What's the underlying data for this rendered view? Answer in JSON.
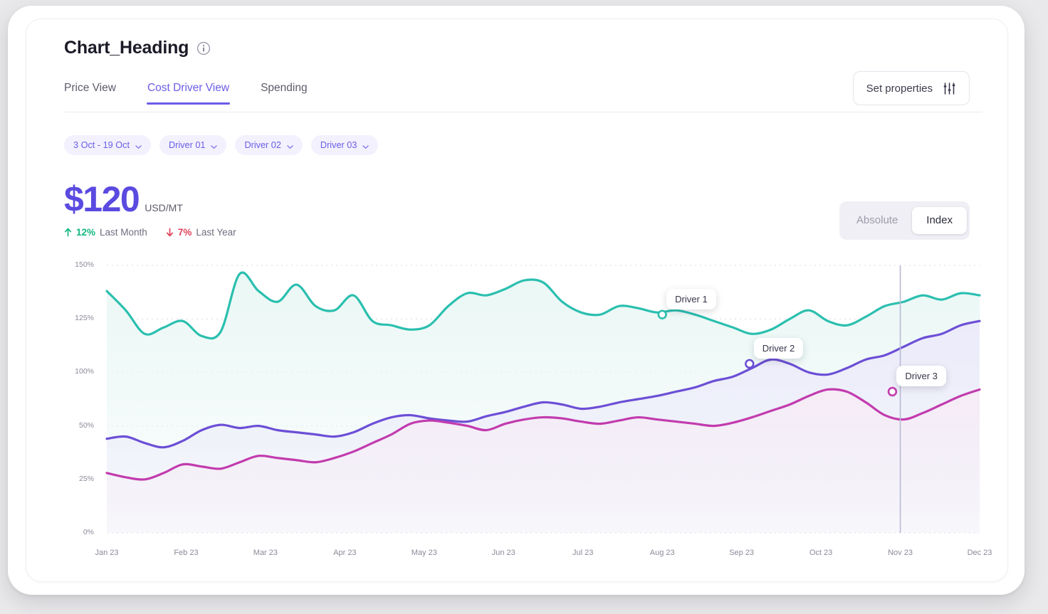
{
  "header": {
    "title": "Chart_Heading",
    "info_icon": "info-circle-icon"
  },
  "tabs": [
    {
      "label": "Price View",
      "active": false
    },
    {
      "label": "Cost Driver View",
      "active": true
    },
    {
      "label": "Spending",
      "active": false
    }
  ],
  "toolbar": {
    "set_properties_label": "Set properties",
    "set_properties_icon": "sliders-icon"
  },
  "filters": [
    {
      "label": "3 Oct - 19 Oct",
      "icon": "chevron-down-icon"
    },
    {
      "label": "Driver 01",
      "icon": "chevron-down-icon"
    },
    {
      "label": "Driver 02",
      "icon": "chevron-down-icon"
    },
    {
      "label": "Driver 03",
      "icon": "chevron-down-icon"
    }
  ],
  "kpi": {
    "value": "$120",
    "unit": "USD/MT",
    "deltas": [
      {
        "direction": "up",
        "icon": "arrow-up-icon",
        "value": "12%",
        "period": "Last Month"
      },
      {
        "direction": "down",
        "icon": "arrow-down-icon",
        "value": "7%",
        "period": "Last Year"
      }
    ]
  },
  "scale_toggle": {
    "options": [
      "Absolute",
      "Index"
    ],
    "selected": "Index"
  },
  "colors": {
    "accent": "#6c5ce7",
    "kpi_value": "#5b4ae0",
    "up": "#14b87d",
    "down": "#e0445c",
    "driver1": "#2bbfaf",
    "driver2": "#6c4fd6",
    "driver3": "#c23bae",
    "chip_bg": "#f2f1fd",
    "grid": "#d9d9e6"
  },
  "chart_data": {
    "type": "line",
    "title": "Chart_Heading",
    "xlabel": "",
    "ylabel": "",
    "ylim": [
      0,
      150
    ],
    "yticks": [
      0,
      25,
      50,
      100,
      125,
      150
    ],
    "ytick_labels": [
      "0%",
      "25%",
      "50%",
      "100%",
      "125%",
      "150%"
    ],
    "grid": true,
    "legend": "inline-callouts",
    "categories": [
      "Jan 23",
      "Feb 23",
      "Mar 23",
      "Apr 23",
      "May 23",
      "Jun 23",
      "Jul 23",
      "Aug 23",
      "Sep 23",
      "Oct 23",
      "Nov 23",
      "Dec 23"
    ],
    "marker_line_x": "Nov 23",
    "callouts": [
      {
        "label": "Driver 1",
        "series": "Driver 1",
        "x": 7.0,
        "y": 127
      },
      {
        "label": "Driver 2",
        "series": "Driver 2",
        "x": 8.1,
        "y": 104
      },
      {
        "label": "Driver 3",
        "series": "Driver 3",
        "x": 9.9,
        "y": 82
      },
      {
        "label": "Driver 1",
        "series": "Driver 1",
        "x": 7.0,
        "y": 127
      }
    ],
    "series": [
      {
        "name": "Driver 1",
        "color": "#2bbfaf",
        "area_fill": "#e9f7f5",
        "values": [
          138,
          129,
          118,
          121,
          124,
          117,
          119,
          146,
          138,
          133,
          141,
          131,
          129,
          136,
          124,
          122,
          120,
          122,
          131,
          137,
          136,
          139,
          143,
          142,
          133,
          128,
          127,
          131,
          130,
          128,
          129,
          127,
          124,
          121,
          118,
          120,
          125,
          129,
          124,
          122,
          126,
          131,
          133,
          136,
          134,
          137,
          136
        ]
      },
      {
        "name": "Driver 2",
        "color": "#6c4fd6",
        "area_fill": "#eceafa",
        "values": [
          44,
          45,
          42,
          40,
          43,
          48,
          51,
          49,
          50,
          48,
          47,
          46,
          45,
          47,
          52,
          58,
          60,
          57,
          55,
          54,
          59,
          63,
          68,
          72,
          70,
          66,
          68,
          72,
          75,
          78,
          82,
          86,
          92,
          96,
          102,
          106,
          104,
          100,
          98,
          102,
          106,
          108,
          112,
          116,
          118,
          122,
          124
        ]
      },
      {
        "name": "Driver 3",
        "color": "#c23bae",
        "area_fill": "#f6ecf6",
        "values": [
          28,
          26,
          25,
          28,
          32,
          31,
          30,
          33,
          36,
          35,
          34,
          33,
          35,
          38,
          42,
          46,
          52,
          55,
          53,
          50,
          48,
          52,
          56,
          58,
          57,
          54,
          52,
          55,
          58,
          56,
          54,
          52,
          50,
          53,
          58,
          64,
          70,
          78,
          84,
          82,
          72,
          60,
          56,
          62,
          70,
          78,
          84
        ]
      }
    ]
  }
}
